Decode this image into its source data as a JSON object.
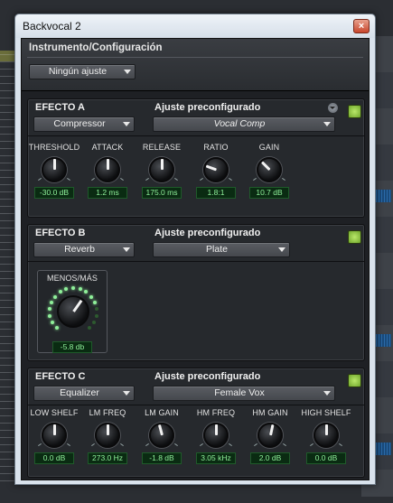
{
  "window": {
    "title": "Backvocal 2",
    "close_label": "×"
  },
  "header": {
    "title": "Instrumento/Configuración",
    "setting": "Ningún ajuste"
  },
  "colors": {
    "led_on": "#8ff09a",
    "led_dim": "#2d5a2f",
    "enable_led": "#9fd04a"
  },
  "effects": {
    "a": {
      "title": "EFECTO A",
      "preset_title": "Ajuste preconfigurado",
      "type": "Compressor",
      "preset": "Vocal Comp",
      "knobs": [
        {
          "label": "THRESHOLD",
          "value": "-30.0 dB"
        },
        {
          "label": "ATTACK",
          "value": "1.2 ms"
        },
        {
          "label": "RELEASE",
          "value": "175.0 ms"
        },
        {
          "label": "RATIO",
          "value": "1.8:1"
        },
        {
          "label": "GAIN",
          "value": "10.7 dB"
        }
      ]
    },
    "b": {
      "title": "EFECTO B",
      "preset_title": "Ajuste preconfigurado",
      "type": "Reverb",
      "preset": "Plate",
      "knob": {
        "label": "MENOS/MÁS",
        "value": "-5.8 db",
        "level": 0.8
      }
    },
    "c": {
      "title": "EFECTO C",
      "preset_title": "Ajuste preconfigurado",
      "type": "Equalizer",
      "preset": "Female Vox",
      "knobs": [
        {
          "label": "LOW SHELF",
          "value": "0.0 dB"
        },
        {
          "label": "LM FREQ",
          "value": "273.0 Hz"
        },
        {
          "label": "LM GAIN",
          "value": "-1.8 dB"
        },
        {
          "label": "HM FREQ",
          "value": "3.05 kHz"
        },
        {
          "label": "HM GAIN",
          "value": "2.0 dB"
        },
        {
          "label": "HIGH SHELF",
          "value": "0.0 dB"
        }
      ]
    }
  }
}
